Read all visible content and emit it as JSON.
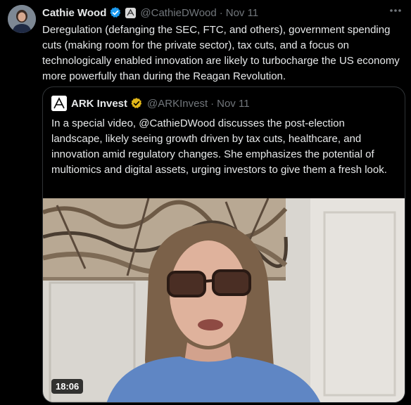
{
  "tweet": {
    "author_name": "Cathie Wood",
    "handle": "@CathieDWood",
    "separator": "·",
    "date": "Nov 11",
    "more_icon": "more-dots-icon",
    "text": "Deregulation (defanging the SEC, FTC, and others), government spending cuts (making room for the private sector), tax cuts, and a focus on technologically enabled innovation are likely to turbocharge the US economy more powerfully than during the Reagan Revolution."
  },
  "quote": {
    "author_name": "ARK Invest",
    "handle": "@ARKInvest",
    "separator": "·",
    "date": "Nov 11",
    "text": "In a special video, @CathieDWood discusses the post-election landscape, likely seeing growth driven by tax cuts, healthcare, and innovation amid regulatory changes. She emphasizes the potential of multiomics and digital assets, urging investors to give them a fresh look.",
    "video_duration": "18:06"
  },
  "colors": {
    "background": "#000000",
    "text_primary": "#e7e9ea",
    "text_muted": "#71767b",
    "verified_blue": "#1d9bf0",
    "verified_gold": "#e2b719",
    "border": "#2f3336"
  }
}
